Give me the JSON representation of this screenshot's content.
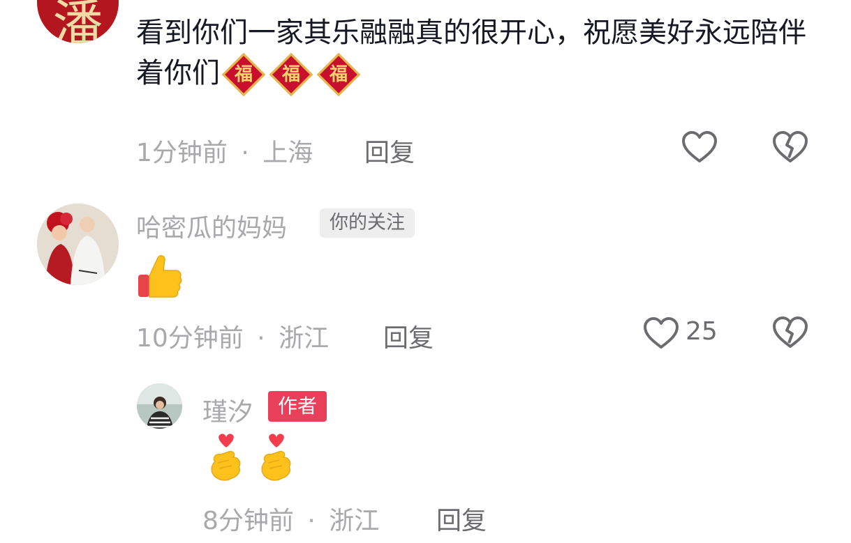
{
  "comments": [
    {
      "avatar_char": "潘",
      "text": "看到你们一家其乐融融真的很开心，祝愿美好永远陪伴着你们",
      "emoji_chars": [
        "福",
        "福",
        "福"
      ],
      "time": "1分钟前",
      "location": "上海",
      "reply_label": "回复"
    },
    {
      "username": "哈密瓜的妈妈",
      "follow_tag": "你的关注",
      "content_emoji": "thumbs-up",
      "time": "10分钟前",
      "location": "浙江",
      "reply_label": "回复",
      "like_count": "25"
    },
    {
      "username": "瑾汐",
      "author_tag": "作者",
      "content_emoji": "finger-heart",
      "time": "8分钟前",
      "location": "浙江",
      "reply_label": "回复"
    }
  ],
  "separator": "·",
  "icons": {
    "like": "heart-outline-icon",
    "dislike": "broken-heart-icon"
  },
  "colors": {
    "author_tag": "#e8405a",
    "follow_tag_bg": "#eeeeee",
    "meta_text": "#a8a8ad"
  }
}
